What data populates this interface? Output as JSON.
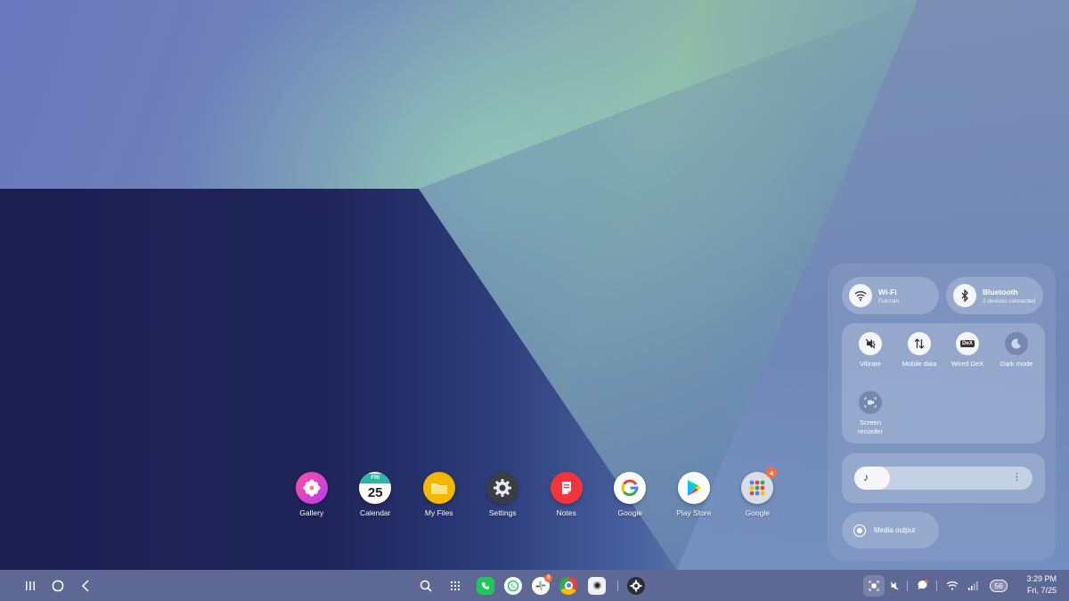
{
  "dock": {
    "apps": [
      {
        "label": "Gallery",
        "icon": "gallery-icon"
      },
      {
        "label": "Calendar",
        "icon": "calendar-icon",
        "day_name": "FRI",
        "day_num": "25"
      },
      {
        "label": "My Files",
        "icon": "folder-icon"
      },
      {
        "label": "Settings",
        "icon": "gear-icon"
      },
      {
        "label": "Notes",
        "icon": "notes-icon"
      },
      {
        "label": "Google",
        "icon": "google-icon"
      },
      {
        "label": "Play Store",
        "icon": "play-store-icon"
      },
      {
        "label": "Google",
        "icon": "google-folder-icon",
        "badge": "4"
      }
    ]
  },
  "quick_panel": {
    "wifi": {
      "label": "Wi-Fi",
      "sub": "Fulcrum",
      "icon": "wifi-icon"
    },
    "bluetooth": {
      "label": "Bluetooth",
      "sub": "2 devices connected",
      "icon": "bluetooth-icon"
    },
    "tiles": [
      {
        "label": "Vibrate",
        "icon": "vibrate-icon",
        "on": true
      },
      {
        "label": "Mobile data",
        "icon": "mobile-data-icon",
        "on": true
      },
      {
        "label": "Wired DeX",
        "icon": "dex-icon",
        "on": true,
        "glyph": "DeX"
      },
      {
        "label": "Dark mode",
        "icon": "moon-icon",
        "on": false
      },
      {
        "label": "Screen recorder",
        "icon": "screen-recorder-icon",
        "on": false
      }
    ],
    "volume": {
      "level": 0.2,
      "icon": "music-note-icon",
      "more_icon": "more-vert-icon"
    },
    "media_output": {
      "label": "Media output",
      "icon": "media-output-icon"
    }
  },
  "taskbar": {
    "nav": [
      "recents-icon",
      "home-icon",
      "back-icon"
    ],
    "center": [
      "search-icon",
      "apps-grid-icon",
      "phone-icon",
      "whatsapp-icon",
      "slack-icon",
      "chrome-icon",
      "camera-icon",
      "settings-icon"
    ],
    "slack_badge": "3",
    "battery": "56",
    "time": "3:29 PM",
    "date": "Fri, 7/25"
  },
  "colors": {
    "taskbar": "#5d6894",
    "panel": "#8ca0c8",
    "badge": "#ff6a3d"
  }
}
